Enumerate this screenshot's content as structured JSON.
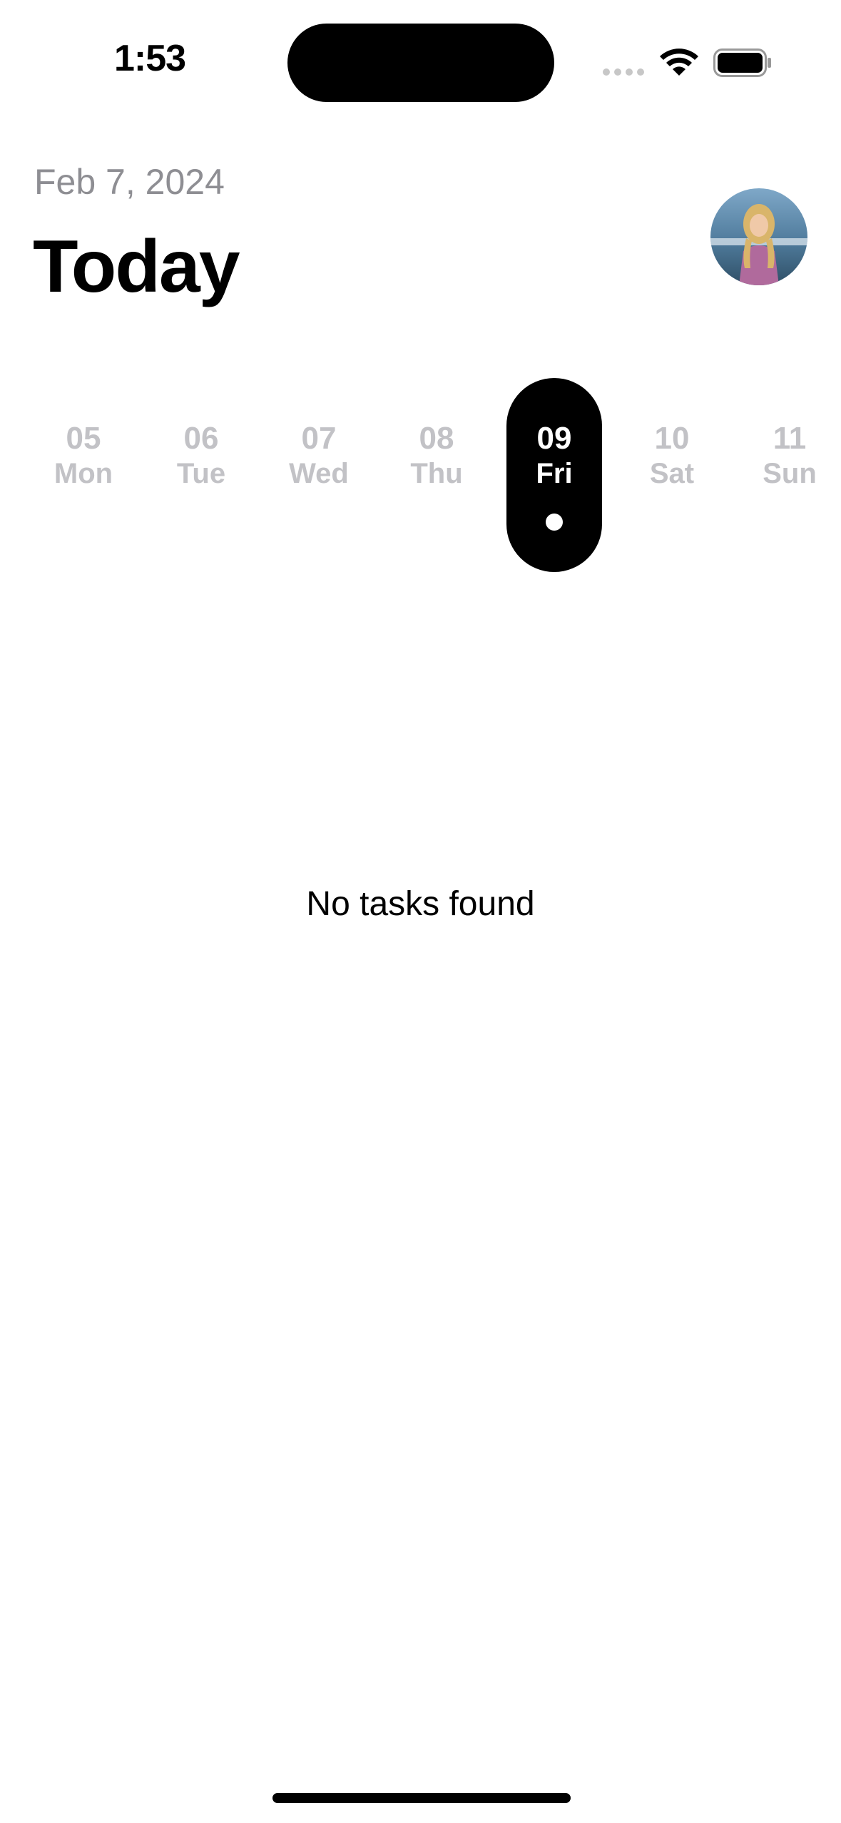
{
  "status_bar": {
    "time": "1:53",
    "icons": [
      "cellular-signal-icon",
      "wifi-icon",
      "battery-icon"
    ]
  },
  "header": {
    "date": "Feb 7, 2024",
    "title": "Today",
    "avatar_icon": "profile-avatar"
  },
  "week": {
    "days": [
      {
        "num": "05",
        "weekday": "Mon"
      },
      {
        "num": "06",
        "weekday": "Tue"
      },
      {
        "num": "07",
        "weekday": "Wed"
      },
      {
        "num": "08",
        "weekday": "Thu"
      },
      {
        "num": "09",
        "weekday": "Fri"
      },
      {
        "num": "10",
        "weekday": "Sat"
      },
      {
        "num": "11",
        "weekday": "Sun"
      }
    ],
    "selected_weekday": "Fri"
  },
  "tasks": {
    "empty_message": "No tasks found"
  },
  "colors": {
    "accent": "#000000",
    "muted_text": "#8e8e93",
    "inactive_day": "#c2c2c6"
  }
}
